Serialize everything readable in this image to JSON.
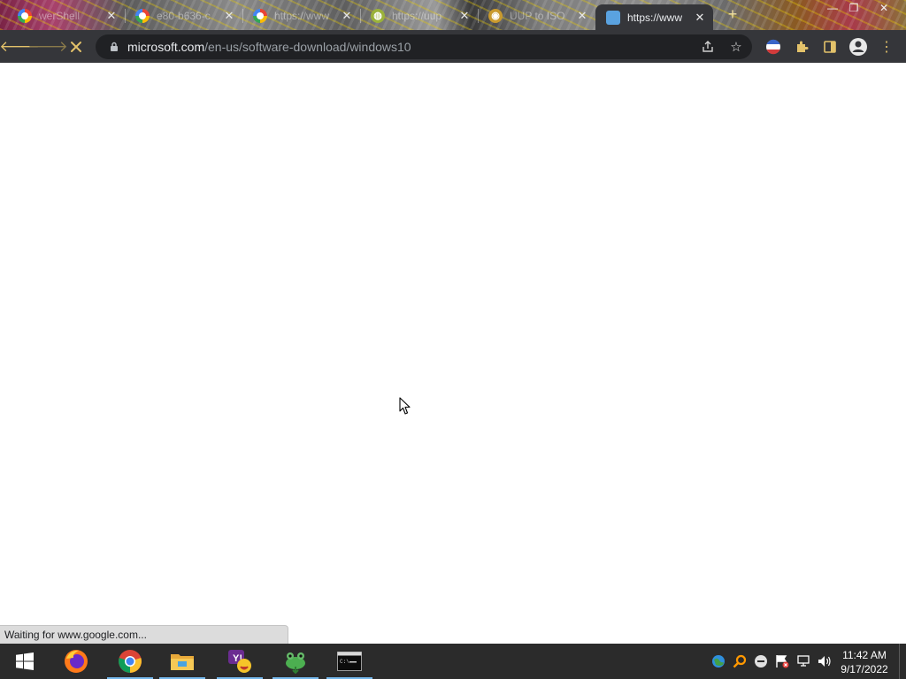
{
  "browser": {
    "tabs": [
      {
        "title": "werShell",
        "icon": "google-icon"
      },
      {
        "title": "e80-b636-c",
        "icon": "google-icon"
      },
      {
        "title": "https://www",
        "icon": "google-icon"
      },
      {
        "title": "https://uup",
        "icon": "globe-icon"
      },
      {
        "title": "UUP to ISO",
        "icon": "uup-icon"
      },
      {
        "title": "https://www",
        "icon": "microsoft-icon",
        "active": true
      }
    ],
    "new_tab_label": "+",
    "address": {
      "host": "microsoft.com",
      "path": "/en-us/software-download/windows10"
    },
    "status_text": "Waiting for www.google.com...",
    "accent_color": "#e3c26a",
    "toolbar_color": "#35363a"
  },
  "taskbar": {
    "apps": [
      "firefox-icon",
      "chrome-icon",
      "file-explorer-icon",
      "yahoo-messenger-icon",
      "frog-icon",
      "command-prompt-icon"
    ],
    "tray": [
      "network-globe-icon",
      "search-tray-icon",
      "minus-circle-icon",
      "flag-alert-icon",
      "network-icon",
      "volume-icon"
    ],
    "time": "11:42 AM",
    "date": "9/17/2022"
  }
}
